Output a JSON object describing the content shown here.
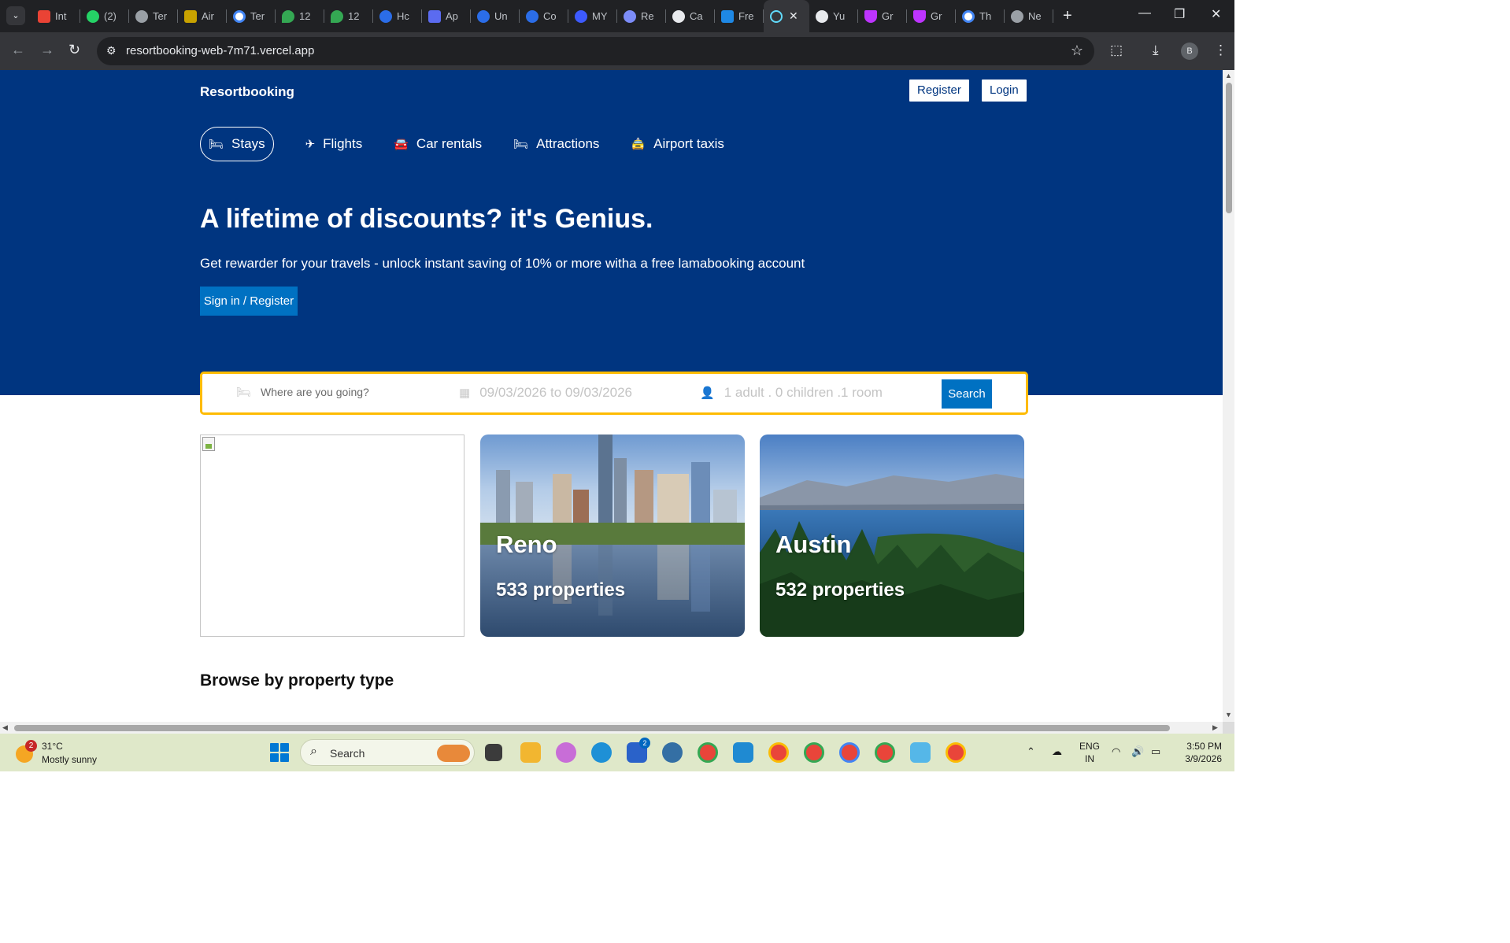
{
  "browser": {
    "tabs": [
      {
        "label": "Int",
        "icon": "gmail-icon",
        "color": "#ea4335"
      },
      {
        "label": "(2)",
        "icon": "whatsapp-icon",
        "color": "#25d366"
      },
      {
        "label": "Ter",
        "icon": "globe-icon",
        "color": "#9aa0a6"
      },
      {
        "label": "Air",
        "icon": "airline-icon",
        "color": "#c8a200"
      },
      {
        "label": "Ter",
        "icon": "google-icon",
        "color": "#4285f4"
      },
      {
        "label": "12",
        "icon": "maps-pin-icon",
        "color": "#34a853"
      },
      {
        "label": "12",
        "icon": "maps-pin-icon",
        "color": "#34a853"
      },
      {
        "label": "Hc",
        "icon": "c-logo-icon",
        "color": "#2b6de8"
      },
      {
        "label": "Ap",
        "icon": "app-icon",
        "color": "#5b6bf0"
      },
      {
        "label": "Un",
        "icon": "c-logo-icon",
        "color": "#2b6de8"
      },
      {
        "label": "Co",
        "icon": "c-logo-icon",
        "color": "#2b6de8"
      },
      {
        "label": "MY",
        "icon": "stack-icon",
        "color": "#3d5afe"
      },
      {
        "label": "Re",
        "icon": "wave-icon",
        "color": "#7c8cf8"
      },
      {
        "label": "Ca",
        "icon": "openai-icon",
        "color": "#e8eaed"
      },
      {
        "label": "Fre",
        "icon": "terminal-icon",
        "color": "#1e88e5"
      },
      {
        "label": "",
        "icon": "react-icon",
        "color": "#61dafb",
        "active": true
      },
      {
        "label": "Yu",
        "icon": "github-icon",
        "color": "#e8eaed"
      },
      {
        "label": "Gr",
        "icon": "vite-icon",
        "color": "#bd34fe"
      },
      {
        "label": "Gr",
        "icon": "vite-icon",
        "color": "#bd34fe"
      },
      {
        "label": "Th",
        "icon": "google-icon",
        "color": "#4285f4"
      },
      {
        "label": "Ne",
        "icon": "chrome-icon",
        "color": "#9aa0a6"
      }
    ],
    "url": "resortbooking-web-7m71.vercel.app",
    "profile_initial": "B"
  },
  "page": {
    "brand": "Resortbooking",
    "auth": {
      "register": "Register",
      "login": "Login"
    },
    "header_list": [
      {
        "label": "Stays",
        "icon": "bed-icon",
        "active": true
      },
      {
        "label": "Flights",
        "icon": "plane-icon"
      },
      {
        "label": "Car rentals",
        "icon": "car-icon"
      },
      {
        "label": "Attractions",
        "icon": "bed-icon"
      },
      {
        "label": "Airport taxis",
        "icon": "taxi-icon"
      }
    ],
    "hero": {
      "title": "A lifetime of discounts? it's Genius.",
      "description": "Get rewarder for your travels - unlock instant saving of 10% or more witha a free lamabooking account",
      "button": "Sign in / Register"
    },
    "search": {
      "destination_placeholder": "Where are you going?",
      "dates": "09/03/2026 to 09/03/2026",
      "guests": "1 adult . 0 children .1 room",
      "button": "Search"
    },
    "featured": [
      {
        "title": "",
        "count": "",
        "image": "broken-image"
      },
      {
        "title": "Reno",
        "count": "533 properties",
        "image": "city-skyline"
      },
      {
        "title": "Austin",
        "count": "532 properties",
        "image": "lake-mountains"
      }
    ],
    "section_title": "Browse by property type"
  },
  "taskbar": {
    "weather_temp": "31°C",
    "weather_desc": "Mostly sunny",
    "weather_badge": "2",
    "search_label": "Search",
    "lang_1": "ENG",
    "lang_2": "IN",
    "time": "3:50 PM",
    "date": "3/9/2026",
    "store_badge": "2"
  }
}
